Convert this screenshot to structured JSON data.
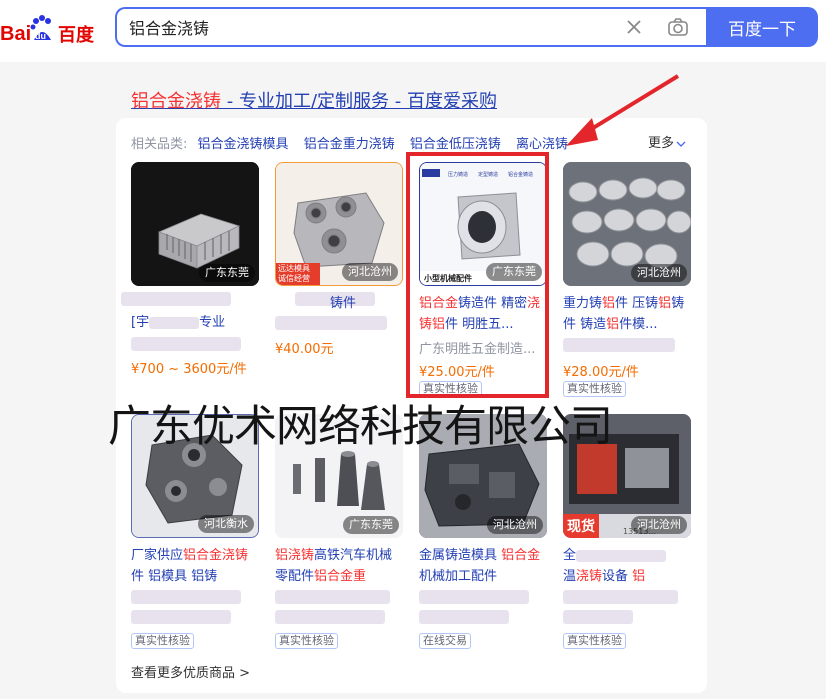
{
  "logo": {
    "text_left": "Bai",
    "text_paw": "du",
    "text_right": "百度"
  },
  "search": {
    "query": "铝合金浇铸",
    "button": "百度一下"
  },
  "result": {
    "title_hl": "铝合金浇铸",
    "title_rest": " - 专业加工/定制服务 - 百度爱采购"
  },
  "related": {
    "label": "相关品类:",
    "items": [
      "铝合金浇铸模具",
      "铝合金重力浇铸",
      "铝合金低压浇铸",
      "离心浇铸"
    ],
    "more": "更多"
  },
  "products": [
    {
      "loc": "广东东莞",
      "title": "[宇",
      "title2": "专业",
      "price": "¥700 ~ 3600元/件"
    },
    {
      "loc": "河北沧州",
      "title": "铸件",
      "price": "¥40.00元",
      "tag1": "远达模具",
      "tag2": "诚信经营"
    },
    {
      "loc": "广东东莞",
      "title_a": "铝合金",
      "title_b": "铸造件 精密",
      "title_c": "浇",
      "title_d": "铸",
      "title_e": "铝",
      "title_f": "件 明胜五...",
      "shop": "广东明胜五金制造...",
      "price": "¥25.00元/件",
      "badge": "真实性核验",
      "img_caption": "小型机械配件",
      "img_tags": [
        "压力铸造",
        "定型铸造",
        "铝合金铸造"
      ]
    },
    {
      "loc": "河北沧州",
      "title_a": "重力铸",
      "title_b": "铝",
      "title_c": "件 压铸",
      "title_d": "铝",
      "title_e": "铸",
      "title_f": "件 铸造",
      "title_g": "铝",
      "title_h": "件模...",
      "price": "¥28.00元/件",
      "badge": "真实性核验"
    },
    {
      "loc": "河北衡水",
      "title_a": "厂家供应",
      "title_b": "铝合金浇铸",
      "title_c": "件 铝模具 铝铸",
      "badge": "真实性核验"
    },
    {
      "loc": "广东东莞",
      "title_a": "铝浇铸",
      "title_b": "高铁汽车机械",
      "title_c": "零配件",
      "title_d": "铝合金重",
      "badge": "真实性核验"
    },
    {
      "loc": "河北沧州",
      "title_a": "金属铸造模具 ",
      "title_b": "铝合金",
      "title_c": "机械加工配件",
      "badge": "在线交易"
    },
    {
      "loc": "河北沧州",
      "title_a": "全",
      "title_b": "温",
      "title_c": "浇铸",
      "title_d": "设备 ",
      "title_e": "铝",
      "badge": "真实性核验",
      "img_badge": "现货",
      "img_phone": "13513..."
    }
  ],
  "see_more": "查看更多优质商品 >",
  "watermark": "广东优术网络科技有限公司",
  "colors": {
    "accent": "#4e6ef2",
    "link": "#2440b3",
    "highlight": "#f73131",
    "price": "#f56c00",
    "box": "#e3262b"
  }
}
